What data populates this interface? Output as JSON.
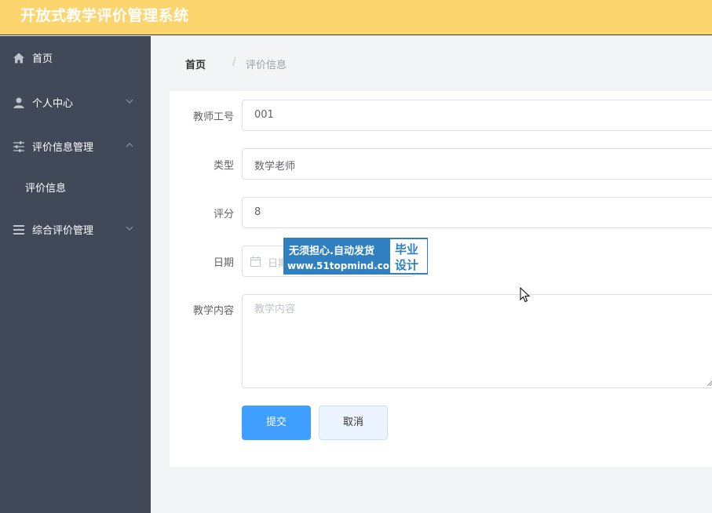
{
  "app": {
    "title": "开放式教学评价管理系统"
  },
  "sidebar": {
    "items": [
      {
        "label": "首页",
        "icon": "home-icon"
      },
      {
        "label": "个人中心",
        "icon": "user-icon"
      },
      {
        "label": "评价信息管理",
        "icon": "sliders-icon"
      },
      {
        "label": "综合评价管理",
        "icon": "menu-lines-icon"
      }
    ],
    "sub_items": [
      {
        "label": "评价信息"
      }
    ]
  },
  "breadcrumb": {
    "home": "首页",
    "separator": "/",
    "current": "评价信息"
  },
  "form": {
    "teacher_id": {
      "label": "教师工号",
      "value": "001"
    },
    "type": {
      "label": "类型",
      "value": "数学老师"
    },
    "score": {
      "label": "评分",
      "value": "8"
    },
    "date": {
      "label": "日期",
      "placeholder": "日期"
    },
    "content": {
      "label": "教学内容",
      "placeholder": "教学内容"
    },
    "submit_label": "提交",
    "cancel_label": "取消"
  },
  "watermark": {
    "line1": "无须担心.自动发货",
    "line2": "www.51topmind.com",
    "badge_line1": "毕业",
    "badge_line2": "设计"
  },
  "colors": {
    "topbar": "#fdd56f",
    "sidebar": "#414959",
    "primary": "#409eff",
    "watermark": "#2f7fc1"
  }
}
